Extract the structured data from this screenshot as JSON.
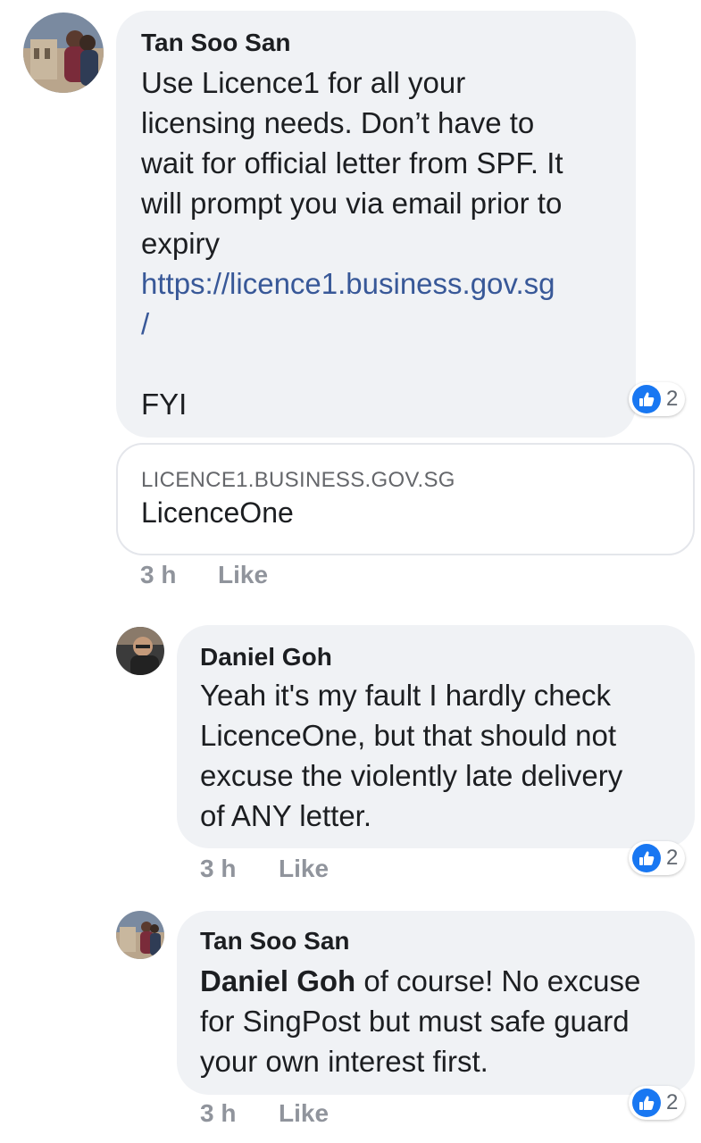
{
  "comments": [
    {
      "author": "Tan Soo San",
      "lines": [
        "Use Licence1 for all your",
        "licensing needs. Don’t have to",
        "wait for official letter from SPF. It",
        "will prompt you via email prior to",
        "expiry"
      ],
      "link_lines": [
        "https://licence1.business.gov.sg",
        "/"
      ],
      "closing": "FYI",
      "reaction_count": "2",
      "preview": {
        "domain": "LICENCE1.BUSINESS.GOV.SG",
        "title": "LicenceOne"
      },
      "time": "3 h",
      "like_label": "Like"
    },
    {
      "author": "Daniel Goh",
      "lines": [
        "Yeah it's my fault I hardly check",
        "LicenceOne, but that should not",
        "excuse the violently late delivery",
        "of ANY letter."
      ],
      "reaction_count": "2",
      "time": "3 h",
      "like_label": "Like"
    },
    {
      "author": "Tan Soo San",
      "mention": "Daniel Goh",
      "lines": [
        " of course! No excuse",
        "for SingPost but must safe guard",
        "your own interest first."
      ],
      "reaction_count": "2",
      "time": "3 h",
      "like_label": "Like"
    }
  ],
  "icons": {
    "reaction": "like-icon",
    "avatar": "avatar"
  },
  "colors": {
    "bubble": "#f0f2f5",
    "link": "#385898",
    "like_blue": "#1877f2",
    "meta": "#90949c"
  }
}
